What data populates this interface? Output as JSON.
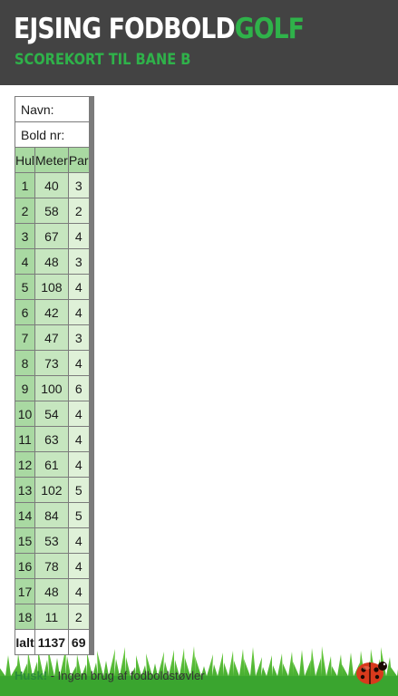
{
  "header": {
    "title_main": "EJSING FODBOLD",
    "title_accent": "GOLF",
    "subtitle": "SCOREKORT TIL BANE B"
  },
  "card": {
    "name_label": "Navn:",
    "ball_label": "Bold nr:",
    "columns": [
      "Hul",
      "Meter",
      "Par"
    ],
    "holes": [
      {
        "hul": "1",
        "meter": "40",
        "par": "3"
      },
      {
        "hul": "2",
        "meter": "58",
        "par": "2"
      },
      {
        "hul": "3",
        "meter": "67",
        "par": "4"
      },
      {
        "hul": "4",
        "meter": "48",
        "par": "3"
      },
      {
        "hul": "5",
        "meter": "108",
        "par": "4"
      },
      {
        "hul": "6",
        "meter": "42",
        "par": "4"
      },
      {
        "hul": "7",
        "meter": "47",
        "par": "3"
      },
      {
        "hul": "8",
        "meter": "73",
        "par": "4"
      },
      {
        "hul": "9",
        "meter": "100",
        "par": "6"
      },
      {
        "hul": "10",
        "meter": "54",
        "par": "4"
      },
      {
        "hul": "11",
        "meter": "63",
        "par": "4"
      },
      {
        "hul": "12",
        "meter": "61",
        "par": "4"
      },
      {
        "hul": "13",
        "meter": "102",
        "par": "5"
      },
      {
        "hul": "14",
        "meter": "84",
        "par": "5"
      },
      {
        "hul": "15",
        "meter": "53",
        "par": "4"
      },
      {
        "hul": "16",
        "meter": "78",
        "par": "4"
      },
      {
        "hul": "17",
        "meter": "48",
        "par": "4"
      },
      {
        "hul": "18",
        "meter": "11",
        "par": "2"
      }
    ],
    "total": {
      "label": "Ialt",
      "meter": "1137",
      "par": "69"
    }
  },
  "footer": {
    "strong": "Husk!",
    "text": " - Ingen brug af fodboldstøvler"
  },
  "colors": {
    "header_bg": "#434343",
    "accent_green": "#2fb24a",
    "hole_col": "#a9d9a2",
    "meter_col": "#c6e6bf",
    "par_col": "#dff1d8"
  },
  "icons": {
    "ladybug": "ladybug-icon",
    "grass": "grass-illustration"
  }
}
